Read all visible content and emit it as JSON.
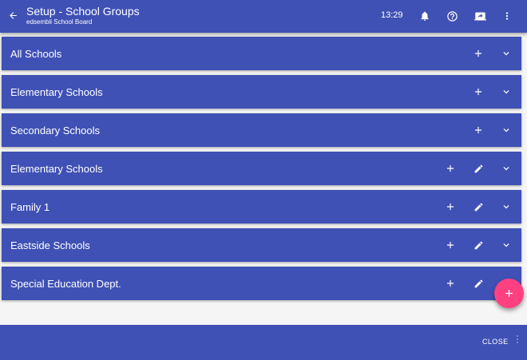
{
  "header": {
    "title": "Setup - School Groups",
    "subtitle": "edsembli School Board",
    "time": "13:29",
    "icons": [
      "arrow-back-icon",
      "bell-icon",
      "help-icon",
      "screen-share-icon",
      "more-vert-icon"
    ]
  },
  "groups": [
    {
      "label": "All Schools",
      "actions": [
        "add-icon",
        "expand-icon"
      ]
    },
    {
      "label": "Elementary Schools",
      "actions": [
        "add-icon",
        "expand-icon"
      ]
    },
    {
      "label": "Secondary Schools",
      "actions": [
        "add-icon",
        "expand-icon"
      ]
    },
    {
      "label": "Elementary Schools",
      "actions": [
        "add-icon",
        "edit-icon",
        "expand-icon"
      ]
    },
    {
      "label": "Family 1",
      "actions": [
        "add-icon",
        "edit-icon",
        "expand-icon"
      ]
    },
    {
      "label": "Eastside Schools",
      "actions": [
        "add-icon",
        "edit-icon",
        "expand-icon"
      ]
    },
    {
      "label": "Special Education Dept.",
      "actions": [
        "add-icon",
        "edit-icon"
      ]
    }
  ],
  "fab": {
    "icon": "add-icon"
  },
  "footer": {
    "close_label": "CLOSE"
  },
  "colors": {
    "primary": "#3f51b5",
    "accent": "#ff4081",
    "background": "#f5f5f5"
  }
}
